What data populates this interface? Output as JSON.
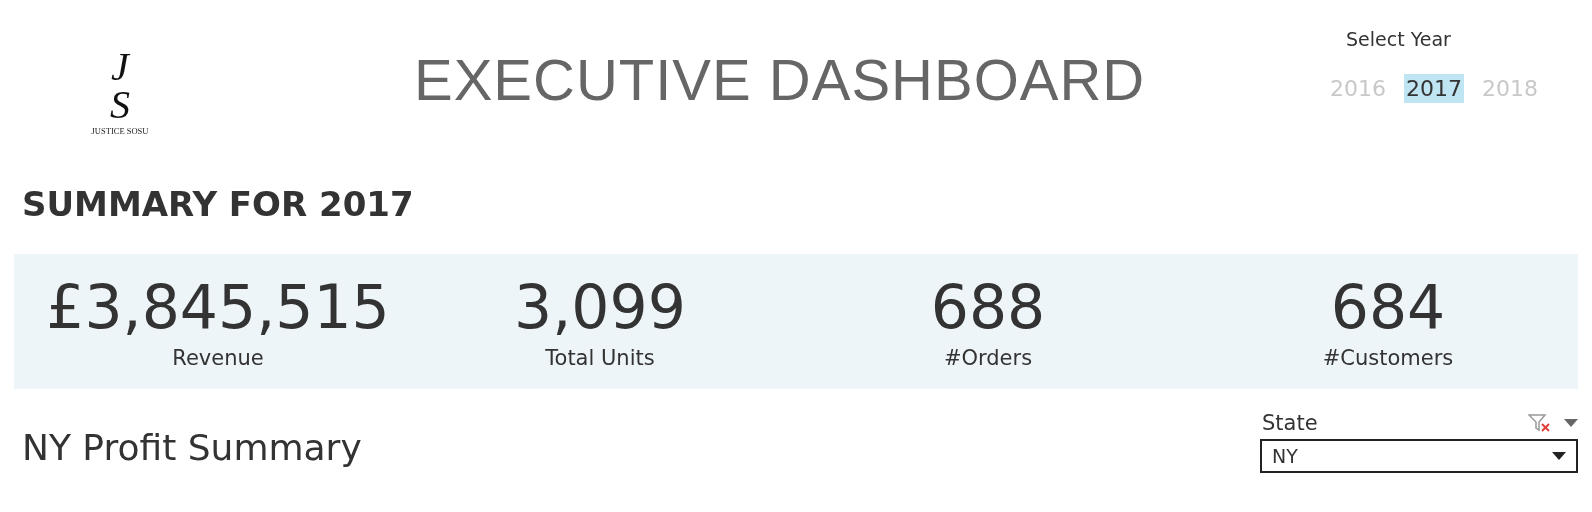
{
  "logo": {
    "letters": [
      "J",
      "S"
    ],
    "text": "JUSTICE SOSU"
  },
  "title": "EXECUTIVE DASHBOARD",
  "year_filter": {
    "label": "Select Year",
    "options": [
      {
        "label": "2016",
        "selected": false
      },
      {
        "label": "2017",
        "selected": true
      },
      {
        "label": "2018",
        "selected": false
      }
    ]
  },
  "summary_heading": "SUMMARY FOR 2017",
  "kpis": [
    {
      "value": "£3,845,515",
      "label": "Revenue"
    },
    {
      "value": "3,099",
      "label": "Total Units"
    },
    {
      "value": "688",
      "label": "#Orders"
    },
    {
      "value": "684",
      "label": "#Customers"
    }
  ],
  "section_title": "NY Profit Summary",
  "state_filter": {
    "label": "State",
    "value": "NY"
  }
}
